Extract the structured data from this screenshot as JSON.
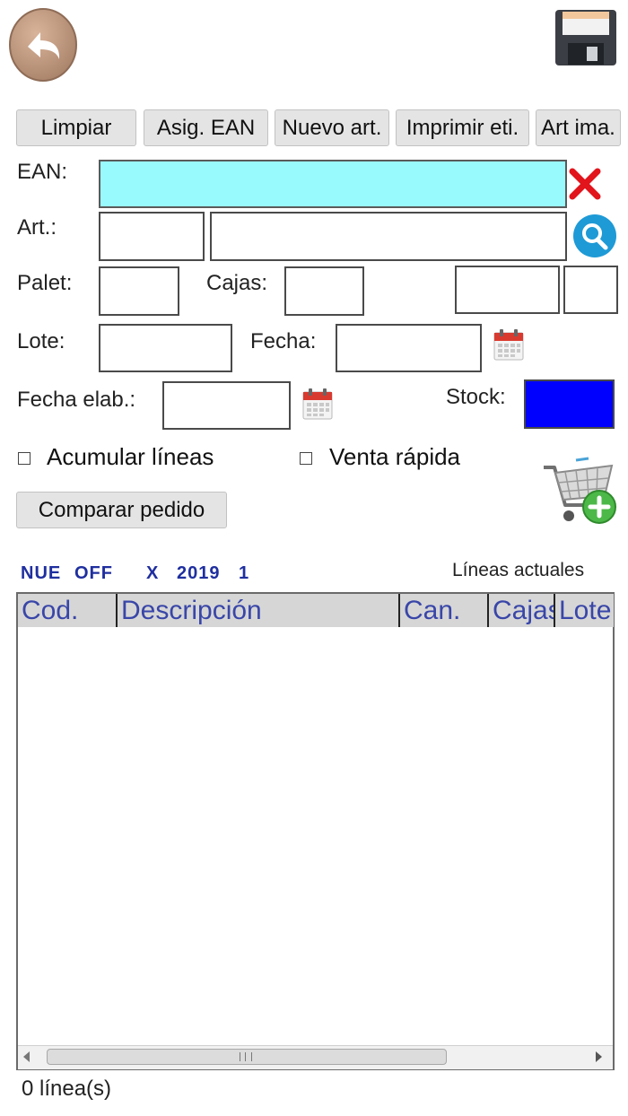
{
  "toolbar": {
    "back_icon": "back-arrow-icon",
    "save_icon": "floppy-disk-icon",
    "buttons": [
      "Limpiar",
      "Asig. EAN",
      "Nuevo art.",
      "Imprimir eti.",
      "Art ima."
    ]
  },
  "form": {
    "ean_label": "EAN:",
    "ean_value": "",
    "ean_color": "#99fafd",
    "art_label": "Art.:",
    "art_code": "",
    "art_desc": "",
    "palet_label": "Palet:",
    "palet_value": "",
    "cajas_label": "Cajas:",
    "cajas_value": "",
    "extra1_value": "",
    "extra2_value": "",
    "lote_label": "Lote:",
    "lote_value": "",
    "fecha_label": "Fecha:",
    "fecha_value": "",
    "fecha_elab_label": "Fecha elab.:",
    "fecha_elab_value": "",
    "stock_label": "Stock:",
    "stock_color": "#0000ff"
  },
  "options": {
    "acumular_label": "Acumular líneas",
    "acumular_checked": false,
    "venta_label": "Venta rápida",
    "venta_checked": false,
    "comparar_label": "Comparar pedido",
    "cart_icon": "add-to-cart-icon"
  },
  "status": {
    "nue": "NUE",
    "off": "OFF",
    "x": "X",
    "year": "2019",
    "num": "1",
    "lineas_actuales": "Líneas actuales"
  },
  "grid": {
    "columns": [
      "Cod.",
      "Descripción",
      "Can.",
      "Cajas",
      "Lote"
    ],
    "rows": [],
    "footer": "0 línea(s)"
  }
}
